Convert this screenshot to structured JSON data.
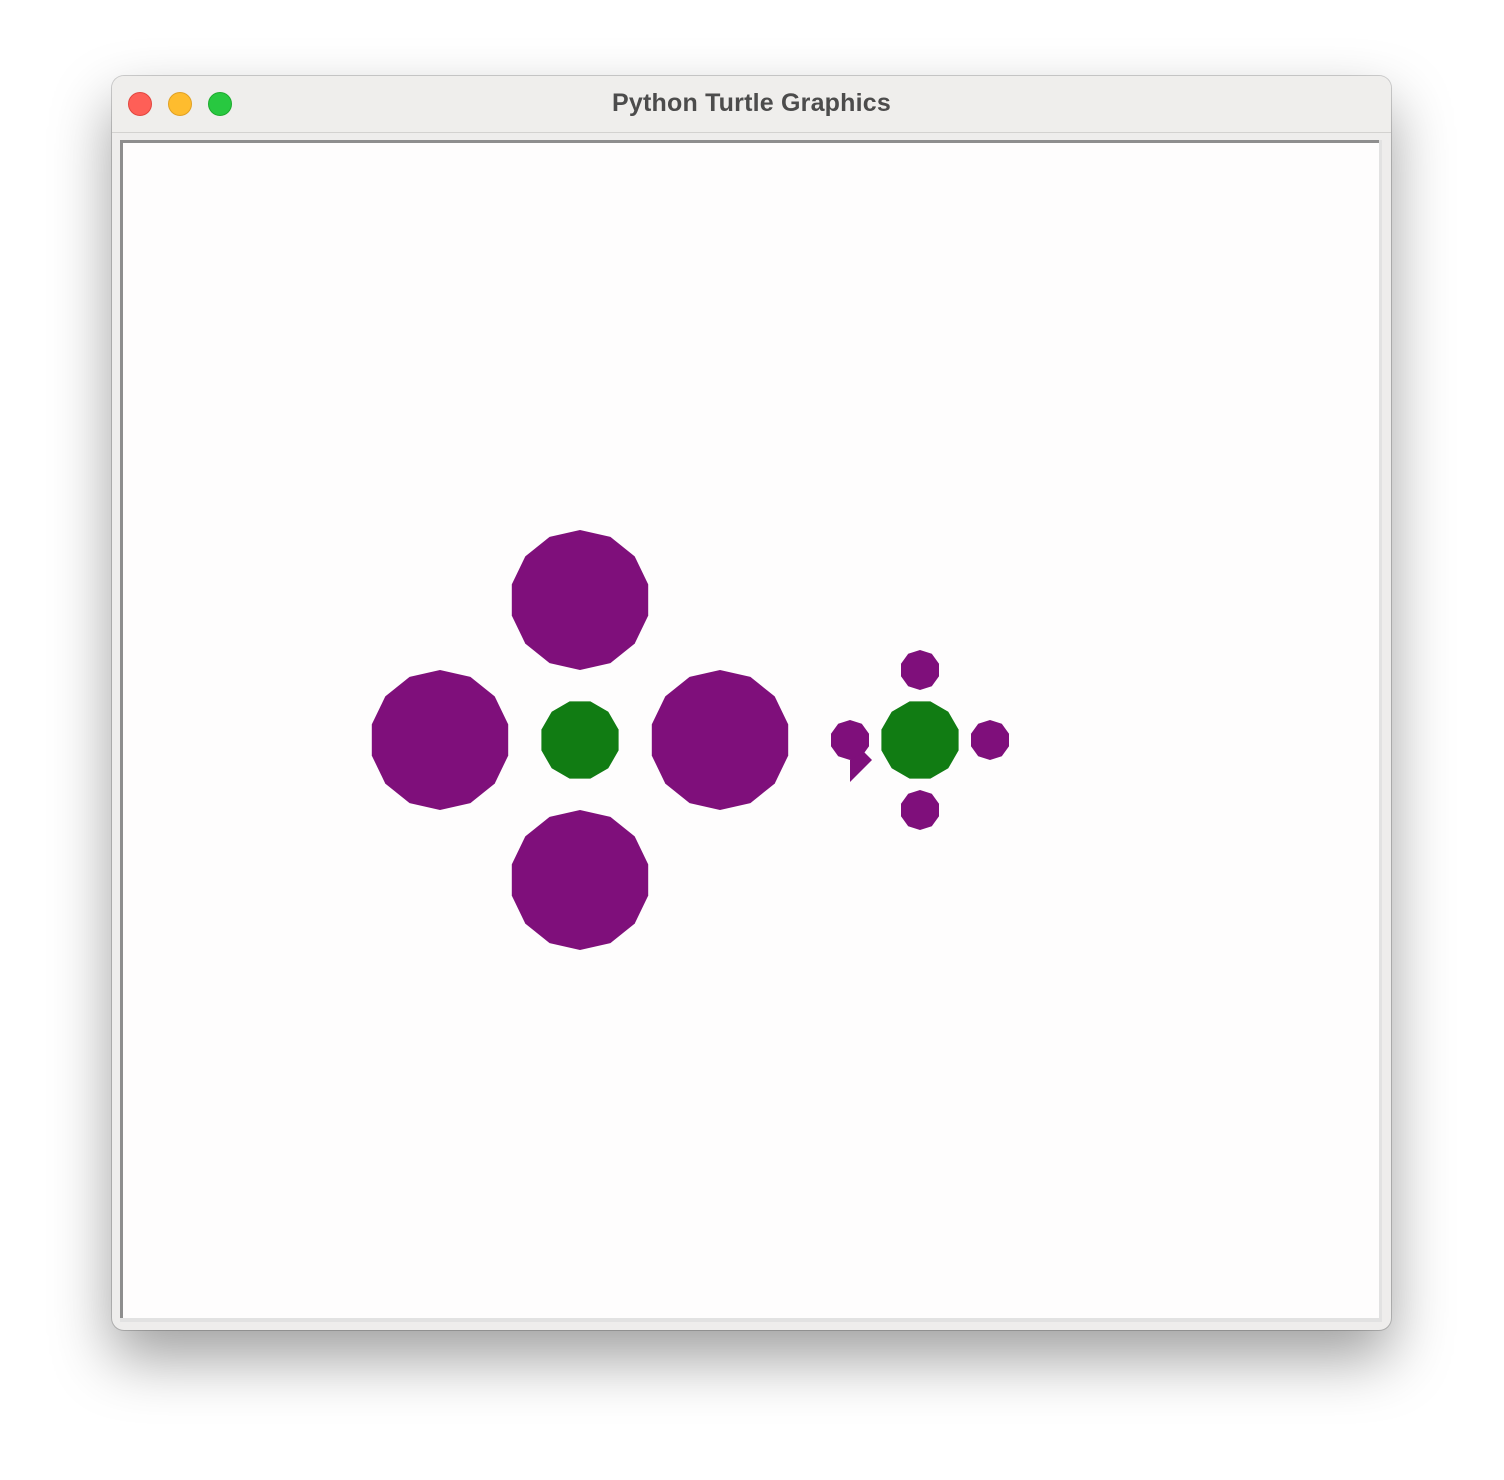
{
  "window": {
    "title": "Python Turtle Graphics"
  },
  "colors": {
    "petal": "#7f0f7b",
    "center": "#117c13",
    "canvas_background": "#fefdfd",
    "close_button": "#fe5f57",
    "minimize_button": "#febc2e",
    "maximize_button": "#28c840"
  },
  "drawing": {
    "shapes": [
      "large-flower: 4 purple petals around a green center",
      "small-flower: 4 purple petals around a green center",
      "turtle-cursor: purple arrow pointing down-right"
    ]
  }
}
